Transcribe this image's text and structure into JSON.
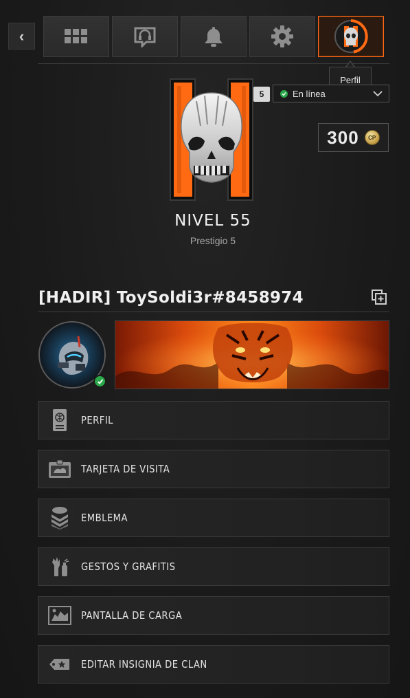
{
  "nav": {
    "back_label": "‹",
    "tabs": [
      {
        "icon": "grid-icon"
      },
      {
        "icon": "headset-chat-icon"
      },
      {
        "icon": "bell-icon"
      },
      {
        "icon": "gear-icon"
      },
      {
        "icon": "profile-icon",
        "active": true
      }
    ],
    "tooltip": "Perfil"
  },
  "status": {
    "rank_badge": "5",
    "selected": "En línea",
    "color": "#2aa84a"
  },
  "currency": {
    "value": "300",
    "coin_label": "CP",
    "icon": "cod-points-icon"
  },
  "level": {
    "title": "NIVEL 55",
    "prestige": "Prestigio 5"
  },
  "player": {
    "name": "[HADIR] ToySoldi3r#8458974",
    "online": true
  },
  "menu": [
    {
      "label": "PERFIL",
      "icon": "id-card-icon"
    },
    {
      "label": "TARJETA DE VISITA",
      "icon": "calling-card-icon"
    },
    {
      "label": "EMBLEMA",
      "icon": "emblem-chevrons-icon"
    },
    {
      "label": "GESTOS Y GRAFITIS",
      "icon": "gesture-spray-icon"
    },
    {
      "label": "PANTALLA DE CARGA",
      "icon": "loading-screen-icon"
    },
    {
      "label": "EDITAR INSIGNIA DE CLAN",
      "icon": "clan-tag-icon"
    }
  ],
  "colors": {
    "accent": "#ff6a13",
    "online": "#2aa84a"
  }
}
